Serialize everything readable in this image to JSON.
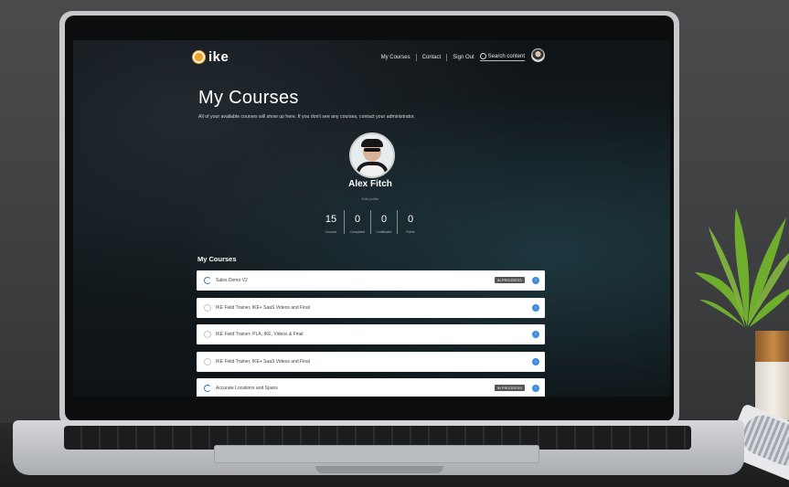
{
  "brand": {
    "name": "ike"
  },
  "nav": {
    "links": [
      "My Courses",
      "Contact",
      "Sign Out"
    ],
    "search_placeholder": "Search content"
  },
  "page": {
    "title": "My Courses",
    "subtitle": "All of your available courses will show up here. If you don't see any courses, contact your administrator."
  },
  "profile": {
    "name": "Alex Fitch",
    "edit_label": "Edit profile"
  },
  "stats": [
    {
      "value": "15",
      "label": "Courses"
    },
    {
      "value": "0",
      "label": "Completed"
    },
    {
      "value": "0",
      "label": "Certificates"
    },
    {
      "value": "0",
      "label": "Points"
    }
  ],
  "courses_section": {
    "title": "My Courses"
  },
  "courses": [
    {
      "name": "Sales Demo V2",
      "status": "IN PROGRESS"
    },
    {
      "name": "IKE Field Trainer, IKE+ SaaS Videos and Final",
      "status": ""
    },
    {
      "name": "IKE Field Trainer- PLA, IKE, Videos & Final",
      "status": ""
    },
    {
      "name": "IKE Field Trainer, IKE+ SaaS Videos and Final",
      "status": ""
    },
    {
      "name": "Accurate Locations and Spans",
      "status": "IN PROGRESS"
    }
  ],
  "colors": {
    "accent": "#3f8be0",
    "logo": "#f4a22a",
    "badge": "#555555"
  }
}
